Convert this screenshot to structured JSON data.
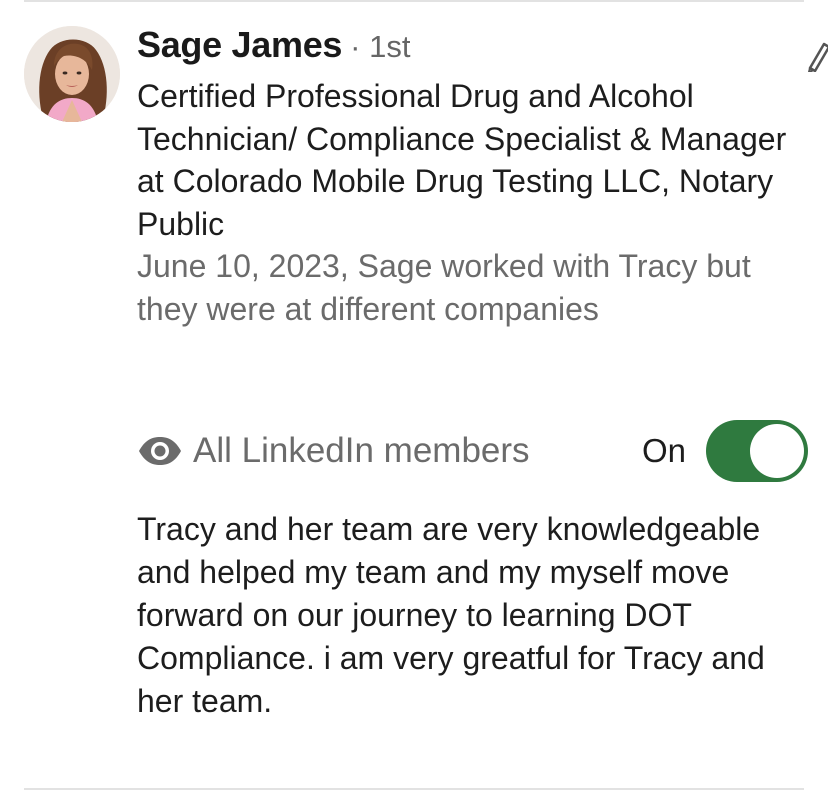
{
  "recommendation": {
    "recommender_name": "Sage James",
    "connection_degree": "· 1st",
    "headline": "Certified Professional Drug and Alcohol Technician/ Compliance Specialist & Manager at Colorado Mobile Drug Testing LLC, Notary Public",
    "relationship": "June 10, 2023, Sage worked with Tracy but they were at different companies",
    "visibility_label": "All LinkedIn members",
    "toggle_state_label": "On",
    "toggle_on": true,
    "text": "Tracy and her team are very knowledgeable and helped my team and my myself move forward on our journey to learning DOT Compliance. i am very greatful for Tracy and her team."
  },
  "icons": {
    "edit": "pencil-icon",
    "visibility": "eye-icon"
  },
  "colors": {
    "toggle_on": "#2f7a3f",
    "secondary_text": "#6b6b6b",
    "primary_text": "#1d1d1d"
  }
}
